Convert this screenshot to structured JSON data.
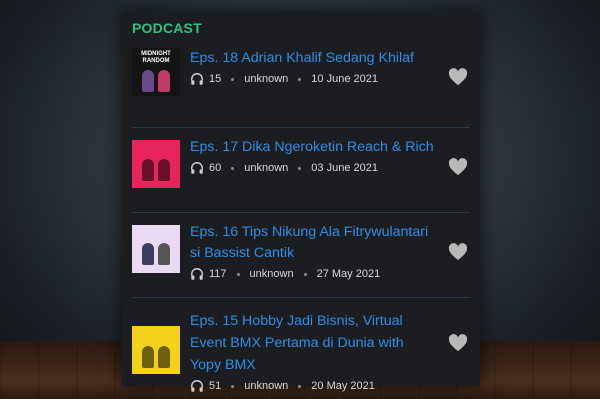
{
  "section": {
    "title": "PODCAST"
  },
  "colors": {
    "accent_green": "#2ec27e",
    "link_blue": "#2f8ee8",
    "panel_bg": "#1b1d20"
  },
  "episodes": [
    {
      "title": "Eps. 18 Adrian Khalif Sedang Khilaf",
      "plays": "15",
      "author": "unknown",
      "date": "10 June 2021",
      "thumb_label": "MIDNIGHT RANDOM",
      "thumb_color": "#141414",
      "thumb_icon": "podcast-cover-image"
    },
    {
      "title": "Eps. 17 Dika Ngeroketin Reach & Rich",
      "plays": "60",
      "author": "unknown",
      "date": "03 June 2021",
      "thumb_label": "",
      "thumb_color": "#e8245c",
      "thumb_icon": "podcast-cover-image"
    },
    {
      "title": "Eps. 16 Tips Nikung Ala Fitrywulantari si Bassist Cantik",
      "plays": "117",
      "author": "unknown",
      "date": "27 May 2021",
      "thumb_label": "",
      "thumb_color": "#e9d9f2",
      "thumb_icon": "podcast-cover-image"
    },
    {
      "title": "Eps. 15 Hobby Jadi Bisnis, Virtual Event BMX Pertama di Dunia with Yopy BMX",
      "plays": "51",
      "author": "unknown",
      "date": "20 May 2021",
      "thumb_label": "",
      "thumb_color": "#f3d21c",
      "thumb_icon": "podcast-cover-image"
    }
  ]
}
